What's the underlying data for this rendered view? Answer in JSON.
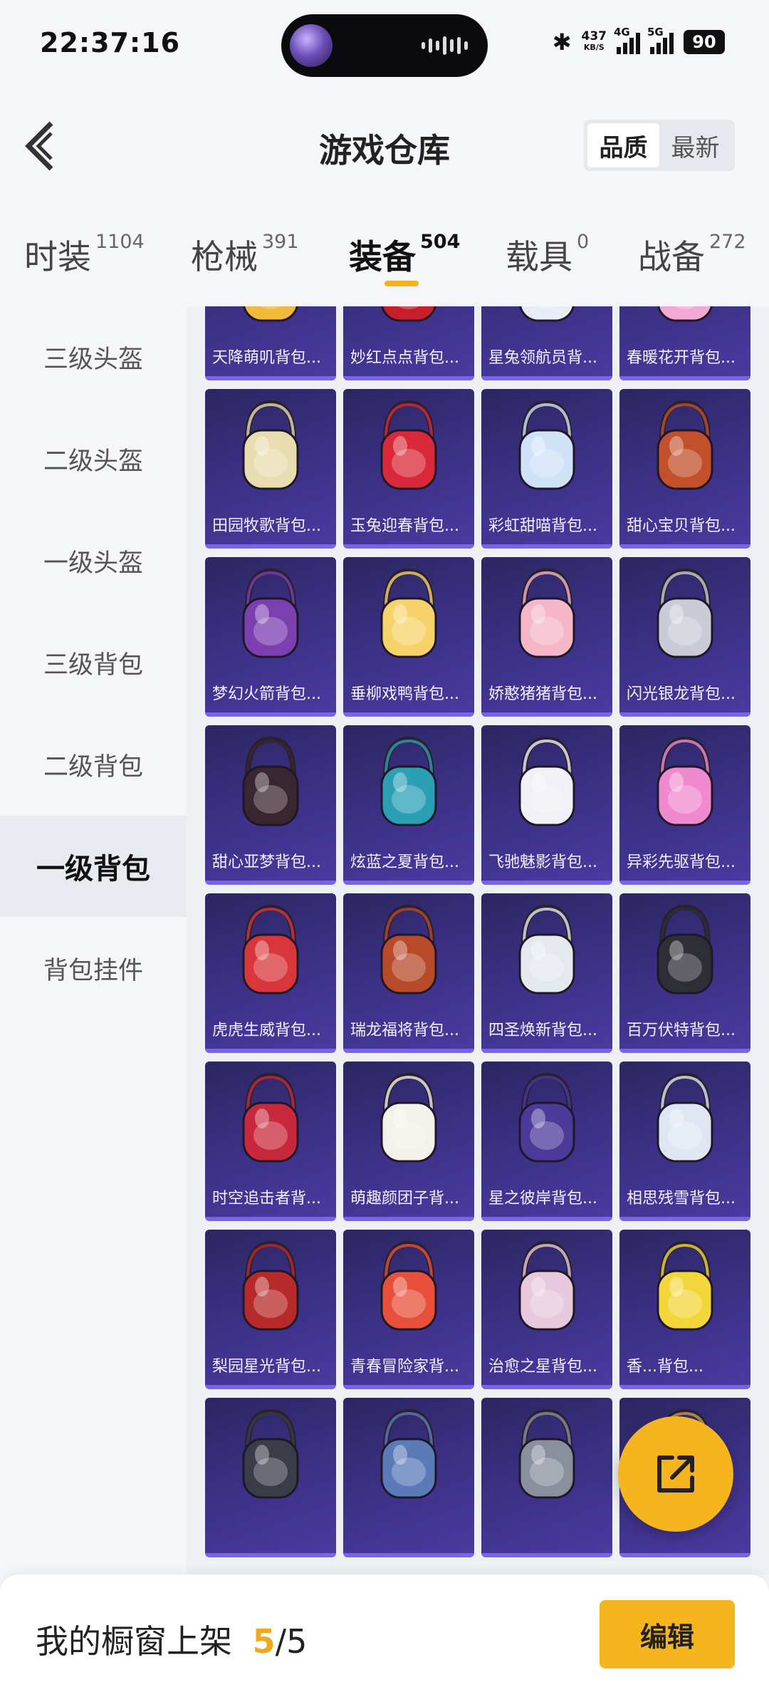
{
  "status_bar": {
    "time": "22:37:16",
    "net_speed": "437",
    "net_unit": "KB/S",
    "sig1": "4G",
    "sig2": "5G",
    "battery": "90"
  },
  "header": {
    "title": "游戏仓库",
    "sort_options": [
      "品质",
      "最新"
    ],
    "sort_selected": "品质"
  },
  "tabs": [
    {
      "label": "时装",
      "count": "1104"
    },
    {
      "label": "枪械",
      "count": "391"
    },
    {
      "label": "装备",
      "count": "504",
      "active": true
    },
    {
      "label": "载具",
      "count": "0"
    },
    {
      "label": "战备",
      "count": "272"
    }
  ],
  "sidenav": [
    {
      "label": "三级头盔"
    },
    {
      "label": "二级头盔"
    },
    {
      "label": "一级头盔"
    },
    {
      "label": "三级背包"
    },
    {
      "label": "二级背包"
    },
    {
      "label": "一级背包",
      "active": true
    },
    {
      "label": "背包挂件"
    }
  ],
  "items": [
    {
      "name": "天降萌叽背包...",
      "color": "#f2b93a"
    },
    {
      "name": "妙红点点背包...",
      "color": "#c81e2a"
    },
    {
      "name": "星兔领航员背...",
      "color": "#e8ecf5"
    },
    {
      "name": "春暖花开背包...",
      "color": "#f4a8d6"
    },
    {
      "name": "田园牧歌背包...",
      "color": "#e9dcb0"
    },
    {
      "name": "玉兔迎春背包...",
      "color": "#d8283a"
    },
    {
      "name": "彩虹甜喵背包...",
      "color": "#cfe2f8"
    },
    {
      "name": "甜心宝贝背包...",
      "color": "#c2502a"
    },
    {
      "name": "梦幻火箭背包...",
      "color": "#7b3fb0"
    },
    {
      "name": "垂柳戏鸭背包...",
      "color": "#f6d36a"
    },
    {
      "name": "娇憨猪猪背包...",
      "color": "#f5b6c8"
    },
    {
      "name": "闪光银龙背包...",
      "color": "#c9ccd6"
    },
    {
      "name": "甜心亚梦背包...",
      "color": "#3a2630"
    },
    {
      "name": "炫蓝之夏背包...",
      "color": "#2b9fb4"
    },
    {
      "name": "飞驰魅影背包...",
      "color": "#f1f0f6"
    },
    {
      "name": "异彩先驱背包...",
      "color": "#f08ad0"
    },
    {
      "name": "虎虎生威背包...",
      "color": "#d8363a"
    },
    {
      "name": "瑞龙福将背包...",
      "color": "#b84a2a"
    },
    {
      "name": "四圣焕新背包...",
      "color": "#e4e8ef"
    },
    {
      "name": "百万伏特背包...",
      "color": "#2e2e36"
    },
    {
      "name": "时空追击者背...",
      "color": "#c8283c"
    },
    {
      "name": "萌趣颜团子背...",
      "color": "#f4f1ea"
    },
    {
      "name": "星之彼岸背包...",
      "color": "#4b3a9a"
    },
    {
      "name": "相思残雪背包...",
      "color": "#dfe6f2"
    },
    {
      "name": "梨园星光背包...",
      "color": "#b82a2a"
    },
    {
      "name": "青春冒险家背...",
      "color": "#e8503a"
    },
    {
      "name": "治愈之星背包...",
      "color": "#e7c8dc"
    },
    {
      "name": "香...背包...",
      "color": "#f2d63a"
    },
    {
      "name": "",
      "color": "#3a3c48"
    },
    {
      "name": "",
      "color": "#5a7ab8"
    },
    {
      "name": "",
      "color": "#8a8f9e"
    },
    {
      "name": "",
      "color": "#c8a060"
    }
  ],
  "bottom": {
    "label": "我的橱窗上架",
    "count": "5",
    "total": "/5",
    "edit": "编辑"
  },
  "colors": {
    "accent": "#f6b51d",
    "card_bg": "#3a2f82",
    "card_border": "#7a63e6"
  }
}
